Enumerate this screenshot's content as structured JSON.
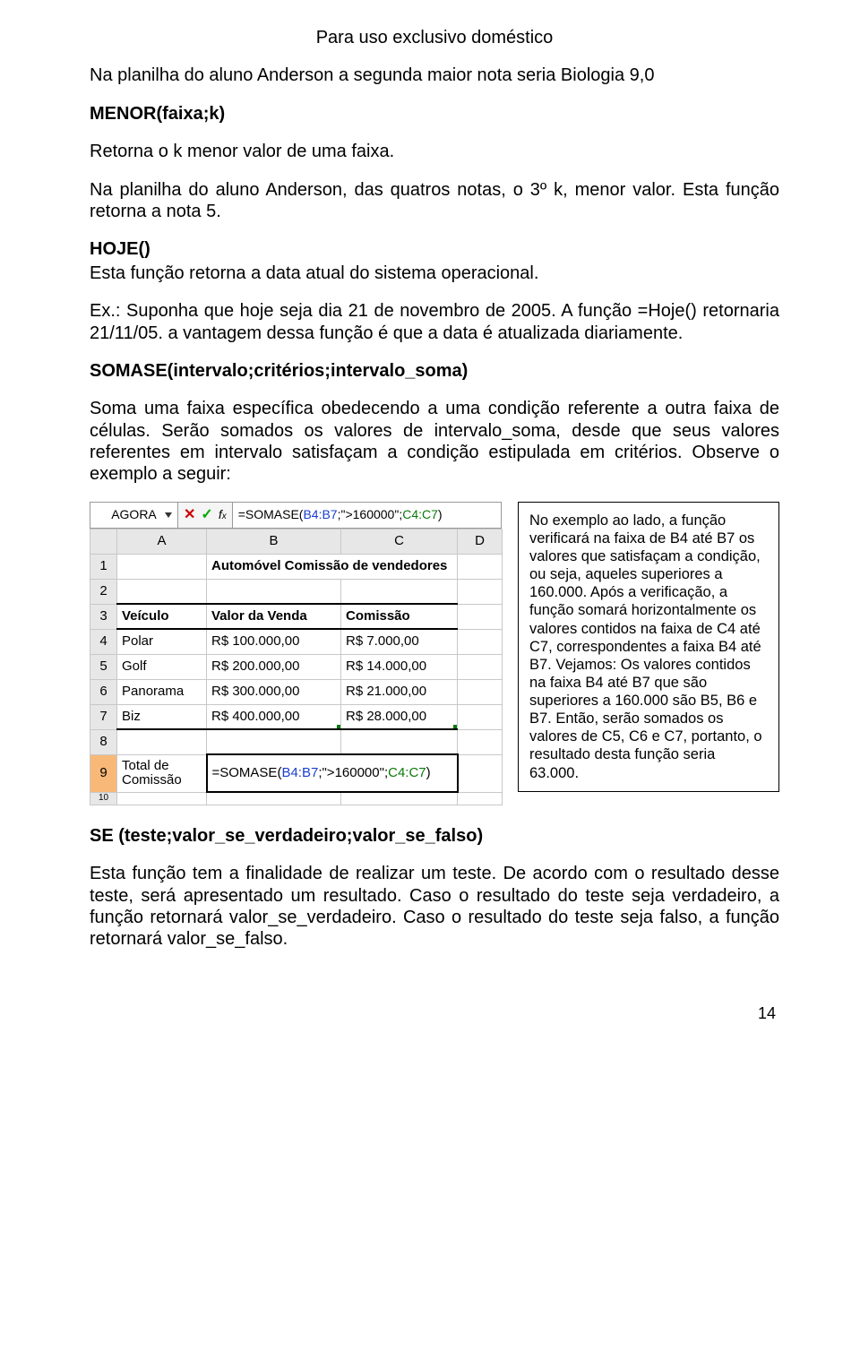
{
  "header": "Para uso exclusivo doméstico",
  "p1": "Na planilha do aluno Anderson a segunda maior nota seria Biologia 9,0",
  "heading_menor": "MENOR(faixa;k)",
  "p2": "Retorna o k menor valor de uma faixa.",
  "p3": "Na planilha do aluno Anderson, das quatros notas, o 3º k, menor valor. Esta função retorna a nota 5.",
  "heading_hoje": "HOJE()",
  "p4": "Esta função retorna a data atual do sistema operacional.",
  "p5": "Ex.: Suponha que hoje seja dia 21 de novembro de 2005. A função =Hoje() retornaria 21/11/05. a vantagem  dessa função é que a data é atualizada diariamente.",
  "heading_somase": "SOMASE(intervalo;critérios;intervalo_soma)",
  "p6": "Soma uma faixa específica obedecendo a uma condição referente a outra faixa de células. Serão somados os valores de intervalo_soma, desde que seus valores referentes em intervalo satisfaçam a condição estipulada em critérios. Observe o exemplo a seguir:",
  "sidebox": "No exemplo ao lado, a função verificará na faixa de B4 até B7 os valores que satisfaçam a condição, ou seja, aqueles superiores a 160.000. Após a verificação, a função somará horizontalmente os valores contidos na faixa de C4 até C7, correspondentes a faixa B4 até B7. Vejamos: Os valores contidos na faixa B4 até B7 que são superiores a 160.000 são B5, B6 e B7. Então, serão somados os valores de C5, C6 e C7, portanto, o resultado desta função seria 63.000.",
  "heading_se": "SE (teste;valor_se_verdadeiro;valor_se_falso)",
  "p7": "Esta função tem a finalidade de realizar um teste. De acordo com o resultado desse teste, será apresentado um resultado. Caso o resultado do teste seja verdadeiro, a função retornará valor_se_verdadeiro. Caso o resultado do teste seja falso, a função retornará valor_se_falso.",
  "page_number": "14",
  "spreadsheet": {
    "namebox": "AGORA",
    "formula_prefix": "=SOMASE(",
    "formula_r1": "B4:B7",
    "formula_mid": ";\">160000\";",
    "formula_r2": "C4:C7",
    "formula_suffix": ")",
    "cols": [
      "A",
      "B",
      "C",
      "D"
    ],
    "rows": {
      "1": {
        "A": "",
        "B": "Automóvel Comissão de vendedores",
        "C": "",
        "D": ""
      },
      "2": {
        "A": "",
        "B": "",
        "C": "",
        "D": ""
      },
      "3": {
        "A": "Veículo",
        "B": "Valor da Venda",
        "C": "Comissão",
        "D": ""
      },
      "4": {
        "A": "Polar",
        "B": "R$      100.000,00",
        "C": "R$     7.000,00",
        "D": ""
      },
      "5": {
        "A": "Golf",
        "B": "R$      200.000,00",
        "C": "R$   14.000,00",
        "D": ""
      },
      "6": {
        "A": "Panorama",
        "B": "R$      300.000,00",
        "C": "R$   21.000,00",
        "D": ""
      },
      "7": {
        "A": "Biz",
        "B": "R$      400.000,00",
        "C": "R$   28.000,00",
        "D": ""
      },
      "8": {
        "A": "",
        "B": "",
        "C": "",
        "D": ""
      },
      "9": {
        "A": "Total de Comissão",
        "B": "=SOMASE(B4:B7;\">160000\";C4:C7)",
        "C": "",
        "D": ""
      },
      "10": {
        "A": "",
        "B": "",
        "C": "",
        "D": ""
      }
    }
  }
}
